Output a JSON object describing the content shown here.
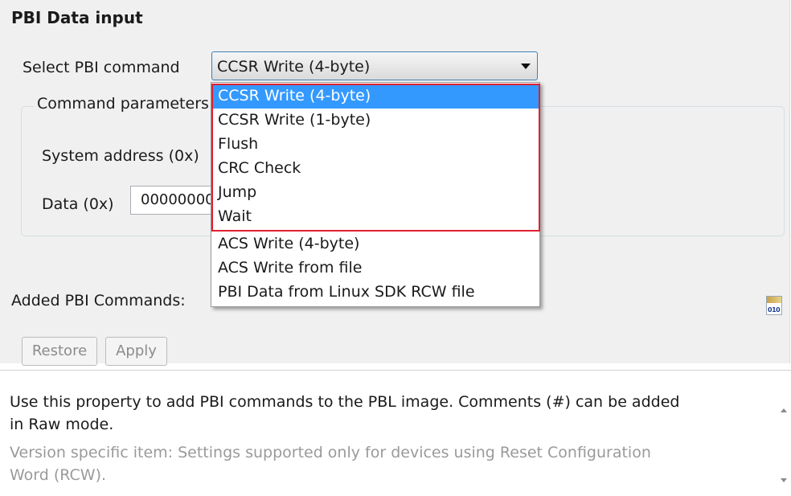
{
  "section": {
    "title": "PBI Data input",
    "select_label": "Select PBI command",
    "select_value": "CCSR Write (4-byte)",
    "group_title": "Command parameters",
    "system_address_label": "System address (0x)",
    "data_label": "Data (0x)",
    "data_value": "00000000"
  },
  "dropdown": {
    "options": [
      "CCSR Write (4-byte)",
      "CCSR Write (1-byte)",
      "Flush",
      "CRC Check",
      "Jump",
      "Wait",
      "ACS Write (4-byte)",
      "ACS Write from file",
      "PBI Data from Linux SDK RCW file"
    ],
    "selected": "CCSR Write (4-byte)"
  },
  "added": {
    "label": "Added PBI Commands:",
    "icon": "binary-file-icon",
    "icon_text": "010"
  },
  "buttons": {
    "restore": "Restore",
    "apply": "Apply"
  },
  "description": {
    "line1": "Use this property to add PBI commands to the PBL image. Comments (#) can be added",
    "line2": "in Raw mode.",
    "line3": "Version specific item: Settings supported only for devices using Reset Configuration",
    "line4": "Word (RCW)."
  },
  "colors": {
    "selection": "#3399ff",
    "highlight_border": "#e0202e",
    "panel_bg": "#f0f0f0"
  }
}
